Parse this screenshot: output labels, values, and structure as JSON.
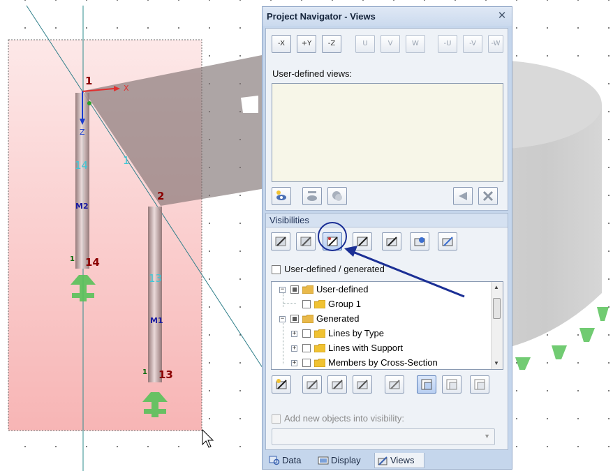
{
  "panel": {
    "title": "Project Navigator - Views",
    "close_glyph": "✕"
  },
  "views": {
    "toolbar": [
      {
        "icon": "view-minus-x-icon",
        "text": "-X",
        "active": true
      },
      {
        "icon": "view-plus-y-icon",
        "text": "+Y",
        "active": true
      },
      {
        "icon": "view-minus-z-icon",
        "text": "-Z",
        "active": true
      },
      {
        "icon": "view-u-icon",
        "text": "U",
        "active": false
      },
      {
        "icon": "view-v-icon",
        "text": "V",
        "active": false
      },
      {
        "icon": "view-w-icon",
        "text": "W",
        "active": false
      },
      {
        "icon": "view-minus-u-icon",
        "text": "-U",
        "active": false
      },
      {
        "icon": "view-minus-v-icon",
        "text": "-V",
        "active": false
      },
      {
        "icon": "view-minus-w-icon",
        "text": "-W",
        "active": false
      }
    ],
    "user_defined_label": "User-defined views:",
    "list_items": [],
    "actions": [
      "new-view-icon",
      "apply-view-icon",
      "copy-view-icon",
      "move-view-icon",
      "delete-view-icon"
    ]
  },
  "visibilities": {
    "header": "Visibilities",
    "tools": [
      "vis-tool-1-icon",
      "vis-tool-2-icon",
      "vis-tool-3-icon",
      "vis-tool-4-icon",
      "vis-tool-5-icon",
      "vis-tool-6-icon",
      "vis-tool-7-icon"
    ],
    "highlighted_tool_index": 2,
    "user_defined_generated": {
      "label": "User-defined / generated",
      "checked": false
    },
    "tree": [
      {
        "label": "User-defined",
        "level": 0,
        "expander": "−",
        "state": "partial"
      },
      {
        "label": "Group 1",
        "level": 1,
        "expander": "",
        "state": "unchecked"
      },
      {
        "label": "Generated",
        "level": 0,
        "expander": "−",
        "state": "partial"
      },
      {
        "label": "Lines by Type",
        "level": 1,
        "expander": "+",
        "state": "unchecked"
      },
      {
        "label": "Lines with Support",
        "level": 1,
        "expander": "+",
        "state": "unchecked"
      },
      {
        "label": "Members by Cross-Section",
        "level": 1,
        "expander": "+",
        "state": "unchecked"
      }
    ],
    "bottom_tools": [
      "vis-add-icon",
      "vis-edit-icon",
      "vis-remove-icon",
      "vis-invert-icon",
      "vis-clear-icon",
      "vis-display-all-icon",
      "vis-display-selected-icon",
      "vis-display-none-icon"
    ],
    "add_new_objects": {
      "label": "Add new objects into visibility:",
      "checked": false,
      "enabled": false
    },
    "dropdown_value": ""
  },
  "tabs": [
    {
      "label": "Data",
      "icon": "data-tab-icon",
      "active": false
    },
    {
      "label": "Display",
      "icon": "display-tab-icon",
      "active": false
    },
    {
      "label": "Views",
      "icon": "views-tab-icon",
      "active": true
    }
  ],
  "model": {
    "nodes": [
      {
        "label": "1"
      },
      {
        "label": "2"
      },
      {
        "label": "14"
      },
      {
        "label": "13"
      }
    ],
    "member_labels": [
      "M2",
      "M1"
    ],
    "line_labels": [
      "14",
      "13",
      "1"
    ],
    "support_labels": [
      "1",
      "1"
    ],
    "axes": {
      "x": "X",
      "z": "Z"
    },
    "colors": {
      "selection_fill": "#f7b5b5",
      "node_label": "#8b0000",
      "line_label": "#3fc7d6",
      "member_label": "#1a1aa0",
      "support": "#59c25a",
      "panel_bg": "#c5d6ec",
      "annotation": "#1b2f95"
    }
  }
}
